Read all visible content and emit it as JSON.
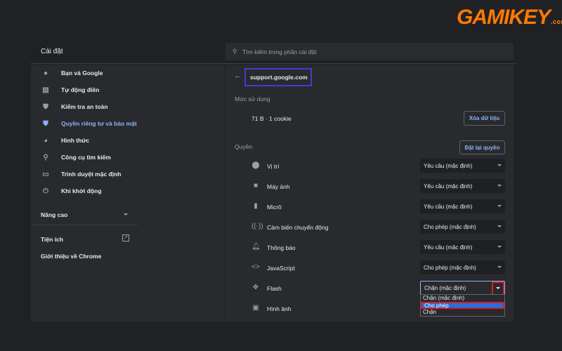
{
  "logo": {
    "text": "GAMIKEY",
    "suffix": ".com"
  },
  "header": {
    "title": "Cài đặt",
    "search_placeholder": "Tìm kiếm trong phần cài đặt"
  },
  "sidebar": {
    "items": [
      {
        "label": "Bạn và Google",
        "icon": "person-icon"
      },
      {
        "label": "Tự động điền",
        "icon": "clipboard-icon"
      },
      {
        "label": "Kiểm tra an toàn",
        "icon": "shield-check-icon"
      },
      {
        "label": "Quyền riêng tư và bảo mật",
        "icon": "shield-icon",
        "active": true
      },
      {
        "label": "Hình thức",
        "icon": "palette-icon"
      },
      {
        "label": "Công cụ tìm kiếm",
        "icon": "search-icon"
      },
      {
        "label": "Trình duyệt mặc định",
        "icon": "browser-icon"
      },
      {
        "label": "Khi khởi động",
        "icon": "power-icon"
      }
    ],
    "advanced": "Nâng cao",
    "extensions": "Tiện ích",
    "about": "Giới thiệu về Chrome"
  },
  "site": {
    "name": "support.google.com",
    "usage_label": "Mức sử dụng",
    "usage": "71 B · 1 cookie",
    "clear_button": "Xóa dữ liệu",
    "permissions_label": "Quyền",
    "reset_button": "Đặt lại quyền"
  },
  "permissions": [
    {
      "name": "Vị trí",
      "value": "Yêu cầu (mặc định)"
    },
    {
      "name": "Máy ảnh",
      "value": "Yêu cầu (mặc định)"
    },
    {
      "name": "Micrô",
      "value": "Yêu cầu (mặc định)"
    },
    {
      "name": "Cảm biến chuyển động",
      "value": "Cho phép (mặc định)"
    },
    {
      "name": "Thông báo",
      "value": "Yêu cầu (mặc định)"
    },
    {
      "name": "JavaScript",
      "value": "Cho phép (mặc định)"
    },
    {
      "name": "Flash",
      "value": "Chặn (mặc định)"
    },
    {
      "name": "Hình ảnh",
      "value": ""
    }
  ],
  "flash_dropdown": {
    "options": [
      "Chặn (mặc định)",
      "Cho phép",
      "Chặn"
    ],
    "highlighted": "Cho phép"
  }
}
